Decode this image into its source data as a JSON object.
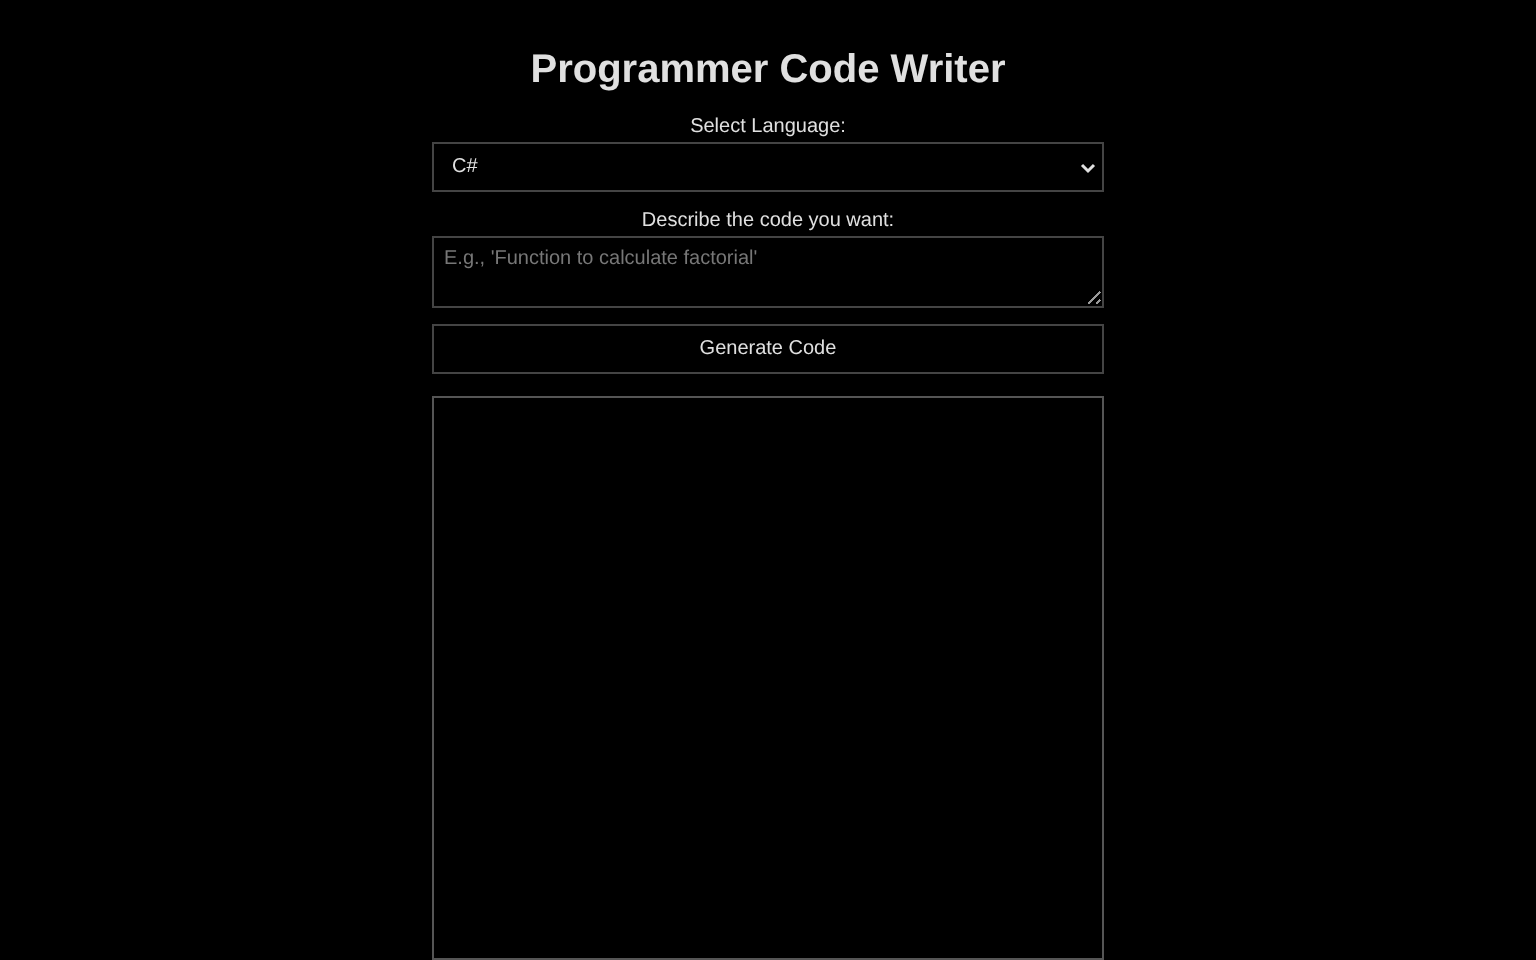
{
  "title": "Programmer Code Writer",
  "language": {
    "label": "Select Language:",
    "value": "C#"
  },
  "description": {
    "label": "Describe the code you want:",
    "placeholder": "E.g., 'Function to calculate factorial'"
  },
  "generate_button": "Generate Code"
}
